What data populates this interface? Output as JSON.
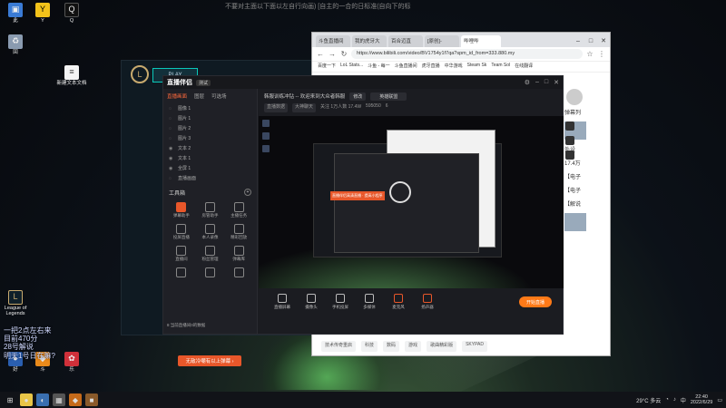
{
  "desktop": {
    "top_notice": "不要对主面以下面以左自行向画)  [自主的一合的日标准(自向下的标",
    "icons": [
      {
        "label": "此"
      },
      {
        "label": "Y"
      },
      {
        "label": "Q"
      },
      {
        "label": "回"
      },
      {
        "label": "新建文本文档"
      },
      {
        "label": "League of Legends"
      },
      {
        "label": "好"
      },
      {
        "label": "斗"
      },
      {
        "label": "乐"
      }
    ],
    "overlay_lines": [
      "一把2点左右来",
      "目前470分",
      "28号解说",
      "明天1号日在嘛?"
    ],
    "sub_banner": "无敌冷嘲有以上弹幕 ›"
  },
  "lol": {
    "play_label": "PLAY"
  },
  "browser": {
    "tabs": [
      "斗鱼直播间",
      "我的虎牙大",
      "百合迈直",
      "[原创]-",
      "哔哩哔"
    ],
    "url": "https://www.bilibili.com/video/BV1754y1f7qa?spm_id_from=333.880.my",
    "bookmarks": [
      "百度一下",
      "LoL Stats...",
      "斗鱼 - 每一",
      "斗鱼直播间",
      "虎牙直播",
      "中华游戏",
      "Steam Sk",
      "Team Sol",
      "在线翻译"
    ],
    "side_labels": [
      "弹幕列",
      "外设",
      "17.4万",
      "【电子",
      "【电子",
      "【解说"
    ],
    "bottom_tags": [
      "技术传奇重启",
      "科技",
      "数码",
      "游戏",
      "歌曲精彩版",
      "SKYPAD"
    ]
  },
  "zbbl": {
    "logo": "直播伴侣",
    "version_tag": "测试",
    "top_nav": [
      "直播画面",
      "图层",
      "可选场"
    ],
    "scenes": [
      "图像 1",
      "图片 1",
      "图片 2",
      "图片 3",
      "文本 2",
      "文本 1",
      "全屏 1",
      "直播画面"
    ],
    "tools_title": "工具箱",
    "tools": [
      "弹幕助手",
      "房管助手",
      "主播任务",
      "投屏直播",
      "本人录像",
      "精彩回放",
      "直播间",
      "粉丝管理",
      "弹幕库",
      "",
      "",
      ""
    ],
    "left_footer": "8 当前直播间0的数据",
    "stream_title": "韩服训练冲钻 -- 欢迎来到大众者韩服",
    "title_chip": "修改",
    "category": "英雄联盟",
    "sub_info": [
      "直播数据",
      "大神聊天",
      "关注 1万人数 17.4W",
      "595050",
      "6"
    ],
    "preview_banner": "直播伴侣高清直播 · 提高小程序",
    "bottom_tools": [
      "直播屏幕",
      "摄像头",
      "手机投屏",
      "多媒体",
      "麦克风",
      "扬声器"
    ],
    "start_label": "开始直播"
  },
  "taskbar": {
    "weather": "29°C 多云",
    "time": "22:40",
    "date": "2022/6/29",
    "lang": "中"
  }
}
